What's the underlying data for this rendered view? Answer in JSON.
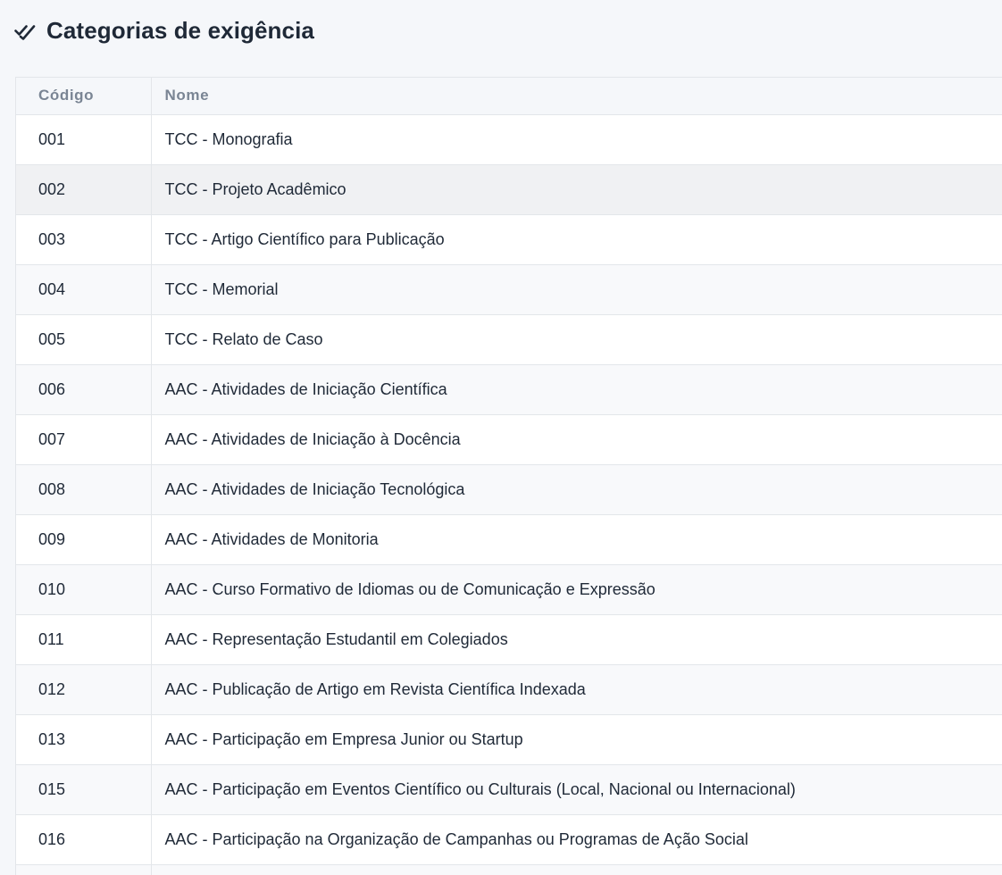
{
  "header": {
    "title": "Categorias de exigência",
    "icon": "double-check-icon"
  },
  "table": {
    "columns": [
      "Código",
      "Nome"
    ],
    "hovered_row_index": 1,
    "rows": [
      {
        "code": "001",
        "name": "TCC - Monografia"
      },
      {
        "code": "002",
        "name": "TCC - Projeto Acadêmico"
      },
      {
        "code": "003",
        "name": "TCC - Artigo Científico para Publicação"
      },
      {
        "code": "004",
        "name": "TCC - Memorial"
      },
      {
        "code": "005",
        "name": "TCC - Relato de Caso"
      },
      {
        "code": "006",
        "name": "AAC - Atividades de Iniciação Científica"
      },
      {
        "code": "007",
        "name": "AAC - Atividades de Iniciação à Docência"
      },
      {
        "code": "008",
        "name": "AAC - Atividades de Iniciação Tecnológica"
      },
      {
        "code": "009",
        "name": "AAC - Atividades de Monitoria"
      },
      {
        "code": "010",
        "name": "AAC - Curso Formativo de Idiomas ou de Comunicação e Expressão"
      },
      {
        "code": "011",
        "name": "AAC - Representação Estudantil em Colegiados"
      },
      {
        "code": "012",
        "name": "AAC - Publicação de Artigo em Revista Científica Indexada"
      },
      {
        "code": "013",
        "name": "AAC - Participação em Empresa Junior ou Startup"
      },
      {
        "code": "015",
        "name": "AAC - Participação em Eventos Científico ou Culturais (Local, Nacional ou Internacional)"
      },
      {
        "code": "016",
        "name": "AAC - Participação na Organização de Campanhas ou Programas de Ação Social"
      }
    ]
  }
}
